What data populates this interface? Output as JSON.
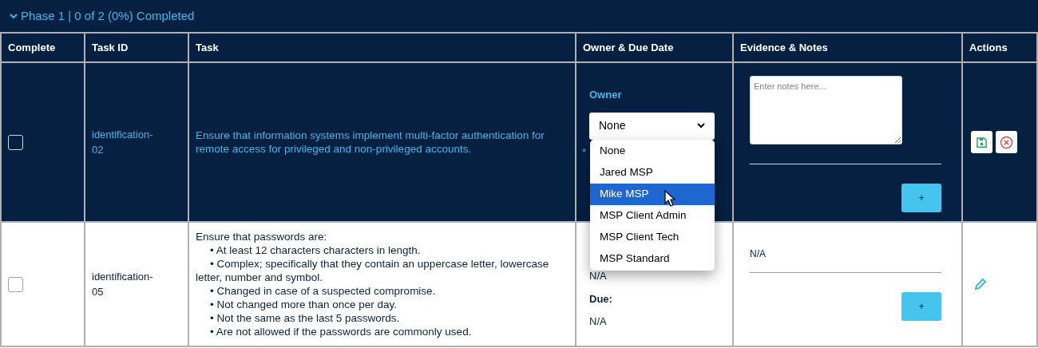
{
  "phase": {
    "title": "Phase 1 | 0 of 2 (0%) Completed",
    "expanded": true
  },
  "columns": [
    "Complete",
    "Task ID",
    "Task",
    "Owner & Due Date",
    "Evidence & Notes",
    "Actions"
  ],
  "rows": [
    {
      "editing": true,
      "checked": false,
      "task_id": "identification-02",
      "task_lines": [
        "Ensure that information systems implement multi-factor authentication for remote access for privileged and non-privileged accounts."
      ],
      "owner_label": "Owner",
      "owner_value": "None",
      "required_mark": "*",
      "notes_placeholder": "Enter notes here...",
      "add_label": "+"
    },
    {
      "editing": false,
      "checked": false,
      "task_id": "identification-05",
      "task_lines": [
        "Ensure that passwords are:",
        "• At least 12 characters characters in length.",
        "• Complex; specifically that they contain an uppercase letter, lowercase letter, number and symbol.",
        "• Changed in case of a suspected compromise.",
        "• Not changed more than once per day.",
        "• Not the same as the last 5 passwords.",
        "• Are not allowed if the passwords are commonly used."
      ],
      "owner_text": "N/A",
      "due_label": "Due:",
      "due_text": "N/A",
      "evidence_text": "N/A",
      "add_label": "+"
    }
  ],
  "owner_menu": [
    {
      "label": "None",
      "selected": false
    },
    {
      "label": "Jared MSP",
      "selected": false
    },
    {
      "label": "Mike MSP",
      "selected": true
    },
    {
      "label": "MSP Client Admin",
      "selected": false
    },
    {
      "label": "MSP Client Tech",
      "selected": false
    },
    {
      "label": "MSP Standard",
      "selected": false
    }
  ]
}
